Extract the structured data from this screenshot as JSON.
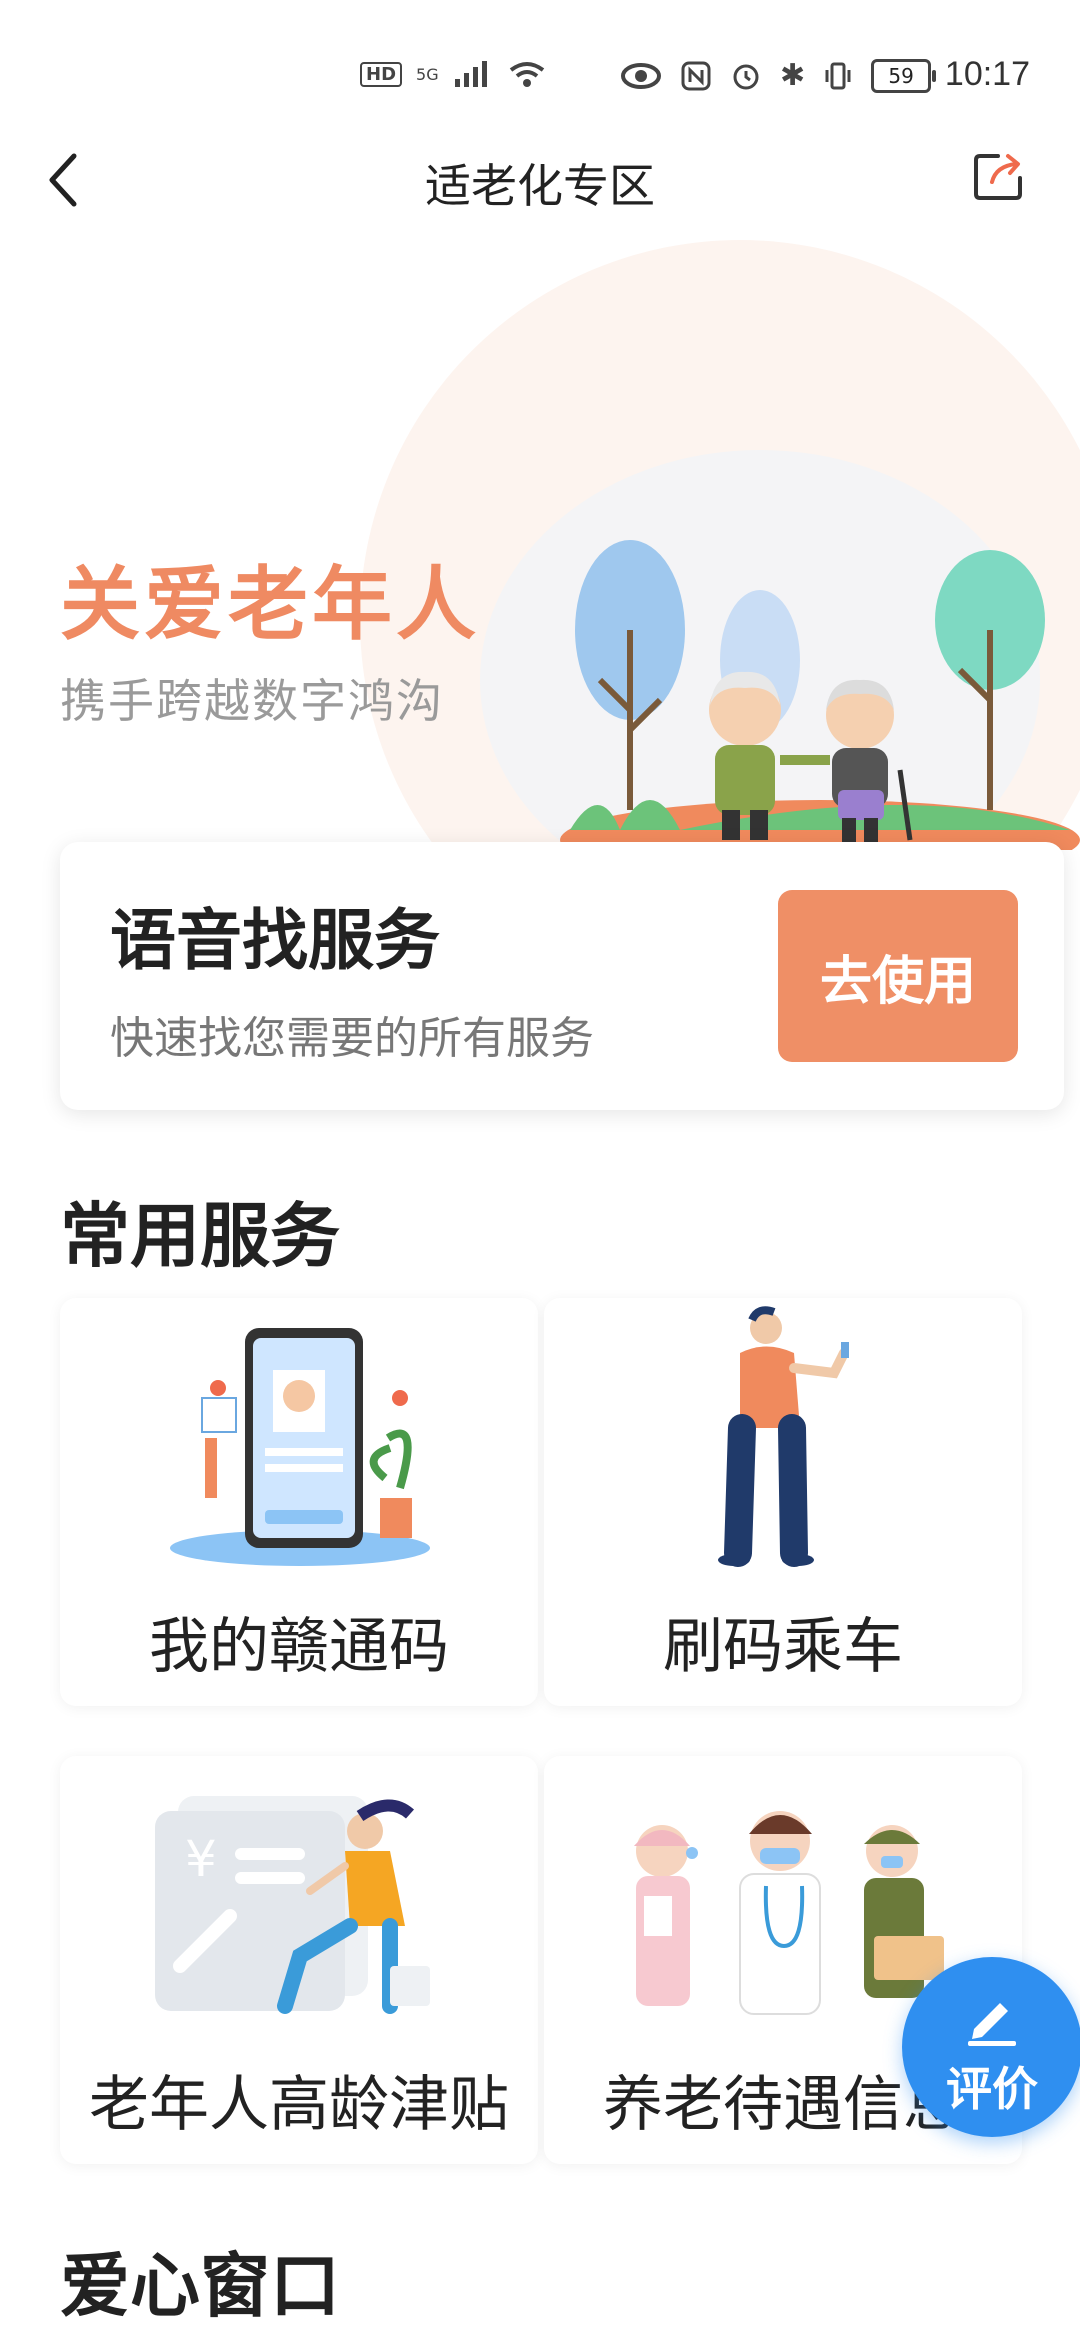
{
  "status_bar": {
    "time": "10:17",
    "network": "5G",
    "hd": "HD",
    "battery": "59"
  },
  "nav": {
    "title": "适老化专区",
    "back_icon": "chevron-left-icon",
    "share_icon": "share-icon"
  },
  "hero": {
    "title": "关爱老年人",
    "subtitle": "携手跨越数字鸿沟"
  },
  "voice_card": {
    "title": "语音找服务",
    "description": "快速找您需要的所有服务",
    "button_label": "去使用"
  },
  "common_services": {
    "title": "常用服务",
    "items": [
      {
        "label": "我的赣通码",
        "icon": "health-code-phone-illustration"
      },
      {
        "label": "刷码乘车",
        "icon": "person-scanning-phone-illustration"
      },
      {
        "label": "老年人高龄津贴",
        "icon": "allowance-illustration"
      },
      {
        "label": "养老待遇信息",
        "icon": "pension-staff-illustration"
      }
    ]
  },
  "love_window": {
    "title": "爱心窗口"
  },
  "fab": {
    "label": "评价",
    "icon": "edit-pen-icon"
  },
  "colors": {
    "accent_orange": "#ef8f66",
    "fab_blue": "#2f8ff0"
  }
}
